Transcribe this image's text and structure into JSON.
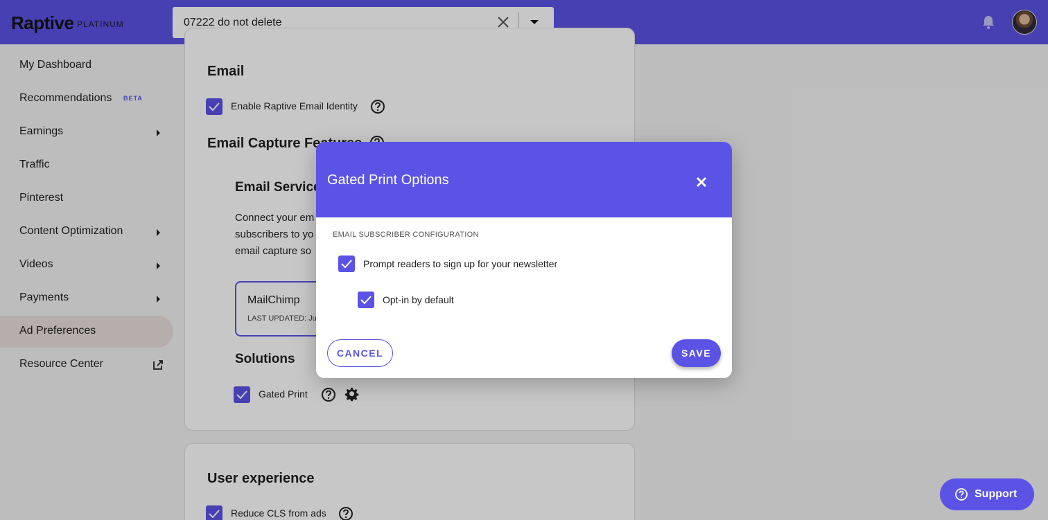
{
  "header": {
    "logo": "Raptive",
    "plan": "PLATINUM",
    "site_select_value": "07222 do not delete"
  },
  "sidebar": {
    "items": [
      {
        "label": "My Dashboard"
      },
      {
        "label": "Recommendations",
        "badge": "BETA"
      },
      {
        "label": "Earnings",
        "has_submenu": true
      },
      {
        "label": "Traffic"
      },
      {
        "label": "Pinterest"
      },
      {
        "label": "Content Optimization",
        "has_submenu": true
      },
      {
        "label": "Videos",
        "has_submenu": true
      },
      {
        "label": "Payments",
        "has_submenu": true
      },
      {
        "label": "Ad Preferences",
        "active": true
      },
      {
        "label": "Resource Center",
        "external": true
      }
    ]
  },
  "main": {
    "email_title": "Email",
    "enable_email_identity": {
      "label": "Enable Raptive Email Identity",
      "checked": true
    },
    "email_capture_title": "Email Capture Features",
    "email_service_title": "Email Service",
    "email_service_desc": [
      "Connect your em",
      "subscribers to yo",
      "email capture so"
    ],
    "provider": {
      "name": "MailChimp",
      "last_updated": "LAST UPDATED: Ju"
    },
    "solutions_title": "Solutions",
    "gated_print": {
      "label": "Gated Print",
      "checked": true
    },
    "user_experience_title": "User experience",
    "reduce_cls": {
      "label": "Reduce CLS from ads",
      "checked": true
    }
  },
  "modal": {
    "title": "Gated Print Options",
    "section_label": "EMAIL SUBSCRIBER CONFIGURATION",
    "prompt_signup": {
      "label": "Prompt readers to sign up for your newsletter",
      "checked": true
    },
    "opt_in_default": {
      "label": "Opt-in by default",
      "checked": true
    },
    "cancel_label": "CANCEL",
    "save_label": "SAVE"
  },
  "support": {
    "label": "Support"
  },
  "colors": {
    "accent": "#5a53e6",
    "active_nav_bg": "#e8dfdb"
  }
}
